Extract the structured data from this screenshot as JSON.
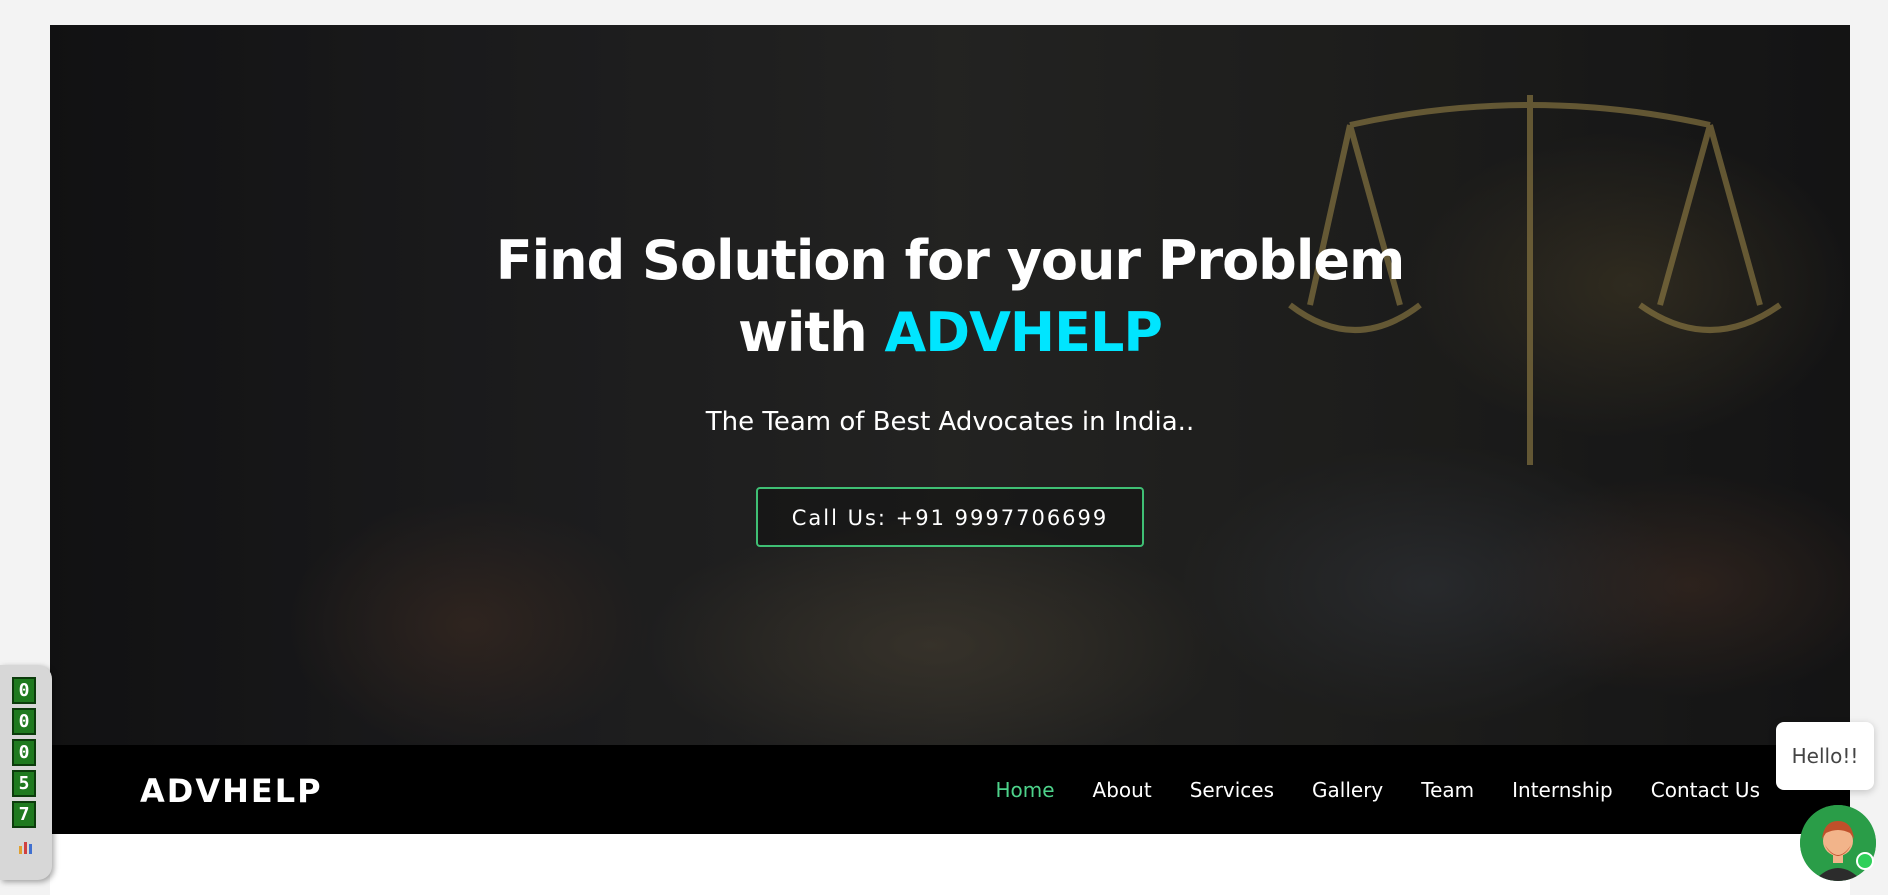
{
  "hero": {
    "title_line1": "Find Solution for your Problem",
    "title_line2_prefix": "with ",
    "title_line2_accent": "ADVHELP",
    "subtitle": "The Team of Best Advocates in India..",
    "cta_label": "Call Us: +91 9997706699"
  },
  "nav": {
    "logo": "ADVHELP",
    "items": [
      {
        "label": "Home",
        "active": true
      },
      {
        "label": "About"
      },
      {
        "label": "Services"
      },
      {
        "label": "Gallery"
      },
      {
        "label": "Team"
      },
      {
        "label": "Internship"
      },
      {
        "label": "Contact Us"
      }
    ]
  },
  "visitor_counter": {
    "digits": [
      "0",
      "0",
      "0",
      "5",
      "7"
    ],
    "icon": "bar-chart-icon"
  },
  "chat": {
    "bubble_text": "Hello!!",
    "avatar_icon": "agent-avatar-icon",
    "status": "online"
  },
  "colors": {
    "accent": "#00e5ff",
    "nav_active": "#4dd28a",
    "cta_border": "#3fbf74",
    "navbar_bg": "#000000"
  }
}
